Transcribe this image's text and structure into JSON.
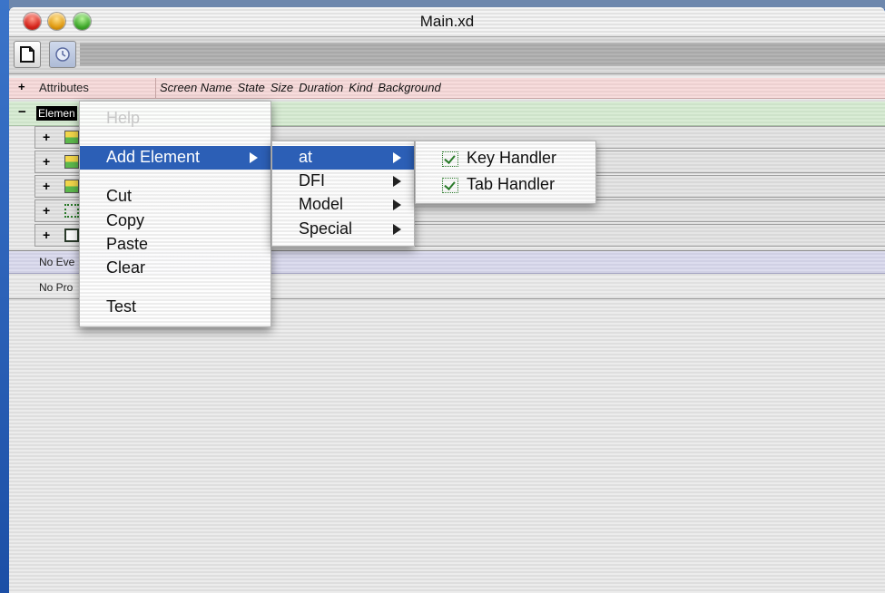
{
  "window": {
    "title": "Main.xd"
  },
  "attributes": {
    "toggle": "+",
    "label": "Attributes",
    "columns": [
      "Screen Name",
      "State",
      "Size",
      "Duration",
      "Kind",
      "Background"
    ]
  },
  "elements": {
    "toggle": "−",
    "label": "Elemen",
    "items": [
      {
        "toggle": "+",
        "icon": "image-icon",
        "label": ""
      },
      {
        "toggle": "+",
        "icon": "image-icon",
        "label": ""
      },
      {
        "toggle": "+",
        "icon": "image-icon",
        "label": ""
      },
      {
        "toggle": "+",
        "icon": "dotted-box-icon",
        "label": ""
      },
      {
        "toggle": "+",
        "icon": "page-icon",
        "label": ""
      }
    ]
  },
  "events": {
    "label": "No Eve"
  },
  "properties": {
    "label": "No Pro"
  },
  "context_menu": {
    "help": "Help",
    "add_element": "Add Element",
    "cut": "Cut",
    "copy": "Copy",
    "paste": "Paste",
    "clear": "Clear",
    "test": "Test"
  },
  "submenu": {
    "at": "at",
    "dfi": "DFI",
    "model": "Model",
    "special": "Special"
  },
  "submenu2": {
    "key_handler": "Key Handler",
    "tab_handler": "Tab Handler"
  },
  "colors": {
    "highlight": "#2c5fb6",
    "attributes_bg": "#f7dcdc",
    "elements_bg": "#d9ecd5",
    "events_bg": "#dcdcee"
  }
}
